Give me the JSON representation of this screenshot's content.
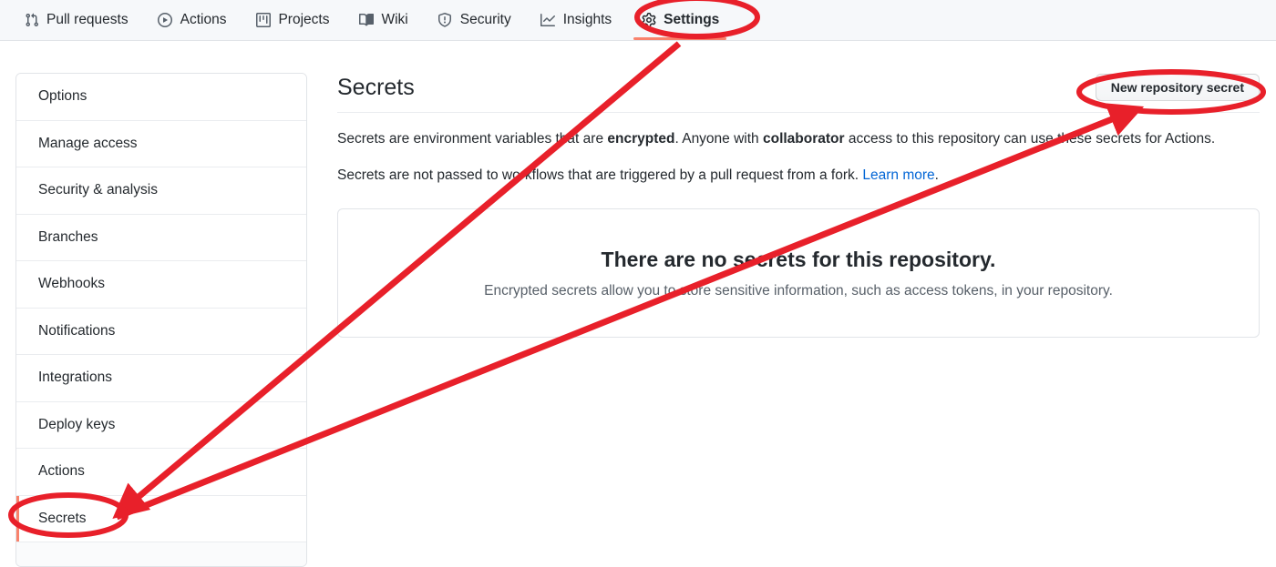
{
  "topnav": {
    "items": [
      {
        "label": "Pull requests",
        "icon": "git-pull-request-icon",
        "active": false
      },
      {
        "label": "Actions",
        "icon": "play-circle-icon",
        "active": false
      },
      {
        "label": "Projects",
        "icon": "project-board-icon",
        "active": false
      },
      {
        "label": "Wiki",
        "icon": "book-icon",
        "active": false
      },
      {
        "label": "Security",
        "icon": "shield-icon",
        "active": false
      },
      {
        "label": "Insights",
        "icon": "graph-icon",
        "active": false
      },
      {
        "label": "Settings",
        "icon": "gear-icon",
        "active": true
      }
    ]
  },
  "sidebar": {
    "items": [
      {
        "label": "Options",
        "active": false
      },
      {
        "label": "Manage access",
        "active": false
      },
      {
        "label": "Security & analysis",
        "active": false
      },
      {
        "label": "Branches",
        "active": false
      },
      {
        "label": "Webhooks",
        "active": false
      },
      {
        "label": "Notifications",
        "active": false
      },
      {
        "label": "Integrations",
        "active": false
      },
      {
        "label": "Deploy keys",
        "active": false
      },
      {
        "label": "Actions",
        "active": false
      },
      {
        "label": "Secrets",
        "active": true
      }
    ]
  },
  "main": {
    "title": "Secrets",
    "new_secret_button": "New repository secret",
    "paragraph1": {
      "part1": "Secrets are environment variables that are ",
      "bold1": "encrypted",
      "part2": ". Anyone with ",
      "bold2": "collaborator",
      "part3": " access to this repository can use these secrets for Actions."
    },
    "paragraph2": {
      "part1": "Secrets are not passed to workflows that are triggered by a pull request from a fork. ",
      "link": "Learn more",
      "part2": "."
    },
    "empty_state": {
      "title": "There are no secrets for this repository.",
      "subtitle": "Encrypted secrets allow you to store sensitive information, such as access tokens, in your repository."
    }
  },
  "annotations": {
    "color": "#e8202a",
    "highlight_settings_tab": "Settings",
    "highlight_new_secret_button": "New repository secret",
    "highlight_secrets_sidebar_item": "Secrets"
  },
  "colors": {
    "accent_orange": "#f9826c",
    "link_blue": "#0366d6",
    "annotation_red": "#e8202a",
    "nav_bg": "#f6f8fa",
    "border": "#e1e4e8"
  }
}
